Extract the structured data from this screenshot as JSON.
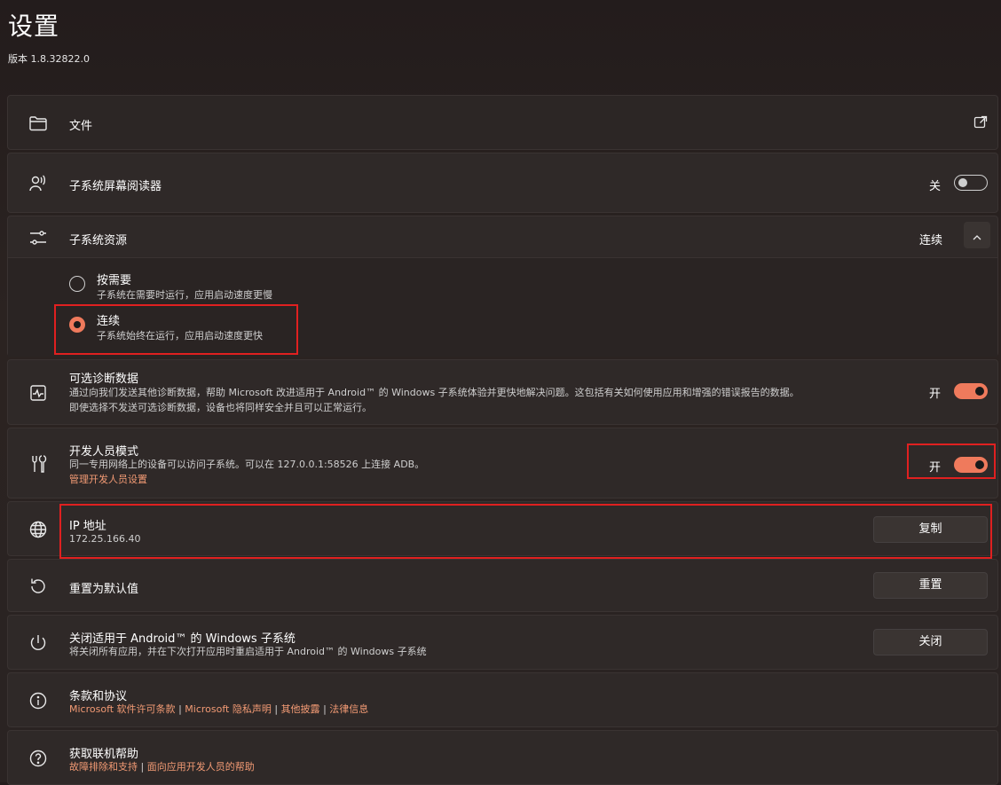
{
  "header": {
    "title": "设置",
    "version": "版本 1.8.32822.0"
  },
  "files": {
    "label": "文件"
  },
  "screen_reader": {
    "label": "子系统屏幕阅读器",
    "state": "关"
  },
  "resources": {
    "label": "子系统资源",
    "value": "连续",
    "options": [
      {
        "label": "按需要",
        "desc": "子系统在需要时运行，应用启动速度更慢"
      },
      {
        "label": "连续",
        "desc": "子系统始终在运行，应用启动速度更快"
      }
    ]
  },
  "diagnostics": {
    "label": "可选诊断数据",
    "desc1": "通过向我们发送其他诊断数据，帮助 Microsoft 改进适用于 Android™ 的 Windows 子系统体验并更快地解决问题。这包括有关如何使用应用和增强的错误报告的数据。",
    "desc2": "即使选择不发送可选诊断数据，设备也将同样安全并且可以正常运行。",
    "state": "开"
  },
  "developer": {
    "label": "开发人员模式",
    "desc": "同一专用网络上的设备可以访问子系统。可以在 127.0.0.1:58526 上连接 ADB。",
    "link": "管理开发人员设置",
    "state": "开"
  },
  "ip": {
    "label": "IP 地址",
    "value": "172.25.166.40",
    "button": "复制"
  },
  "reset": {
    "label": "重置为默认值",
    "button": "重置"
  },
  "shutdown": {
    "label": "关闭适用于 Android™ 的 Windows 子系统",
    "desc": "将关闭所有应用，并在下次打开应用时重启适用于 Android™ 的 Windows 子系统",
    "button": "关闭"
  },
  "terms": {
    "label": "条款和协议",
    "links": [
      "Microsoft 软件许可条款",
      "Microsoft 隐私声明",
      "其他披露",
      "法律信息"
    ],
    "separator": "|"
  },
  "help": {
    "label": "获取联机帮助",
    "links": [
      "故障排除和支持",
      "面向应用开发人员的帮助"
    ],
    "separator": "|"
  },
  "colors": {
    "accent": "#ef7a5c",
    "link": "#f29a74",
    "highlight": "#e02020"
  },
  "icons": [
    "folder-icon",
    "screen-reader-icon",
    "sliders-icon",
    "external-link-icon",
    "chevron-up-icon",
    "diagnostics-icon",
    "developer-tools-icon",
    "globe-icon",
    "reset-icon",
    "power-icon",
    "info-icon",
    "help-icon"
  ]
}
